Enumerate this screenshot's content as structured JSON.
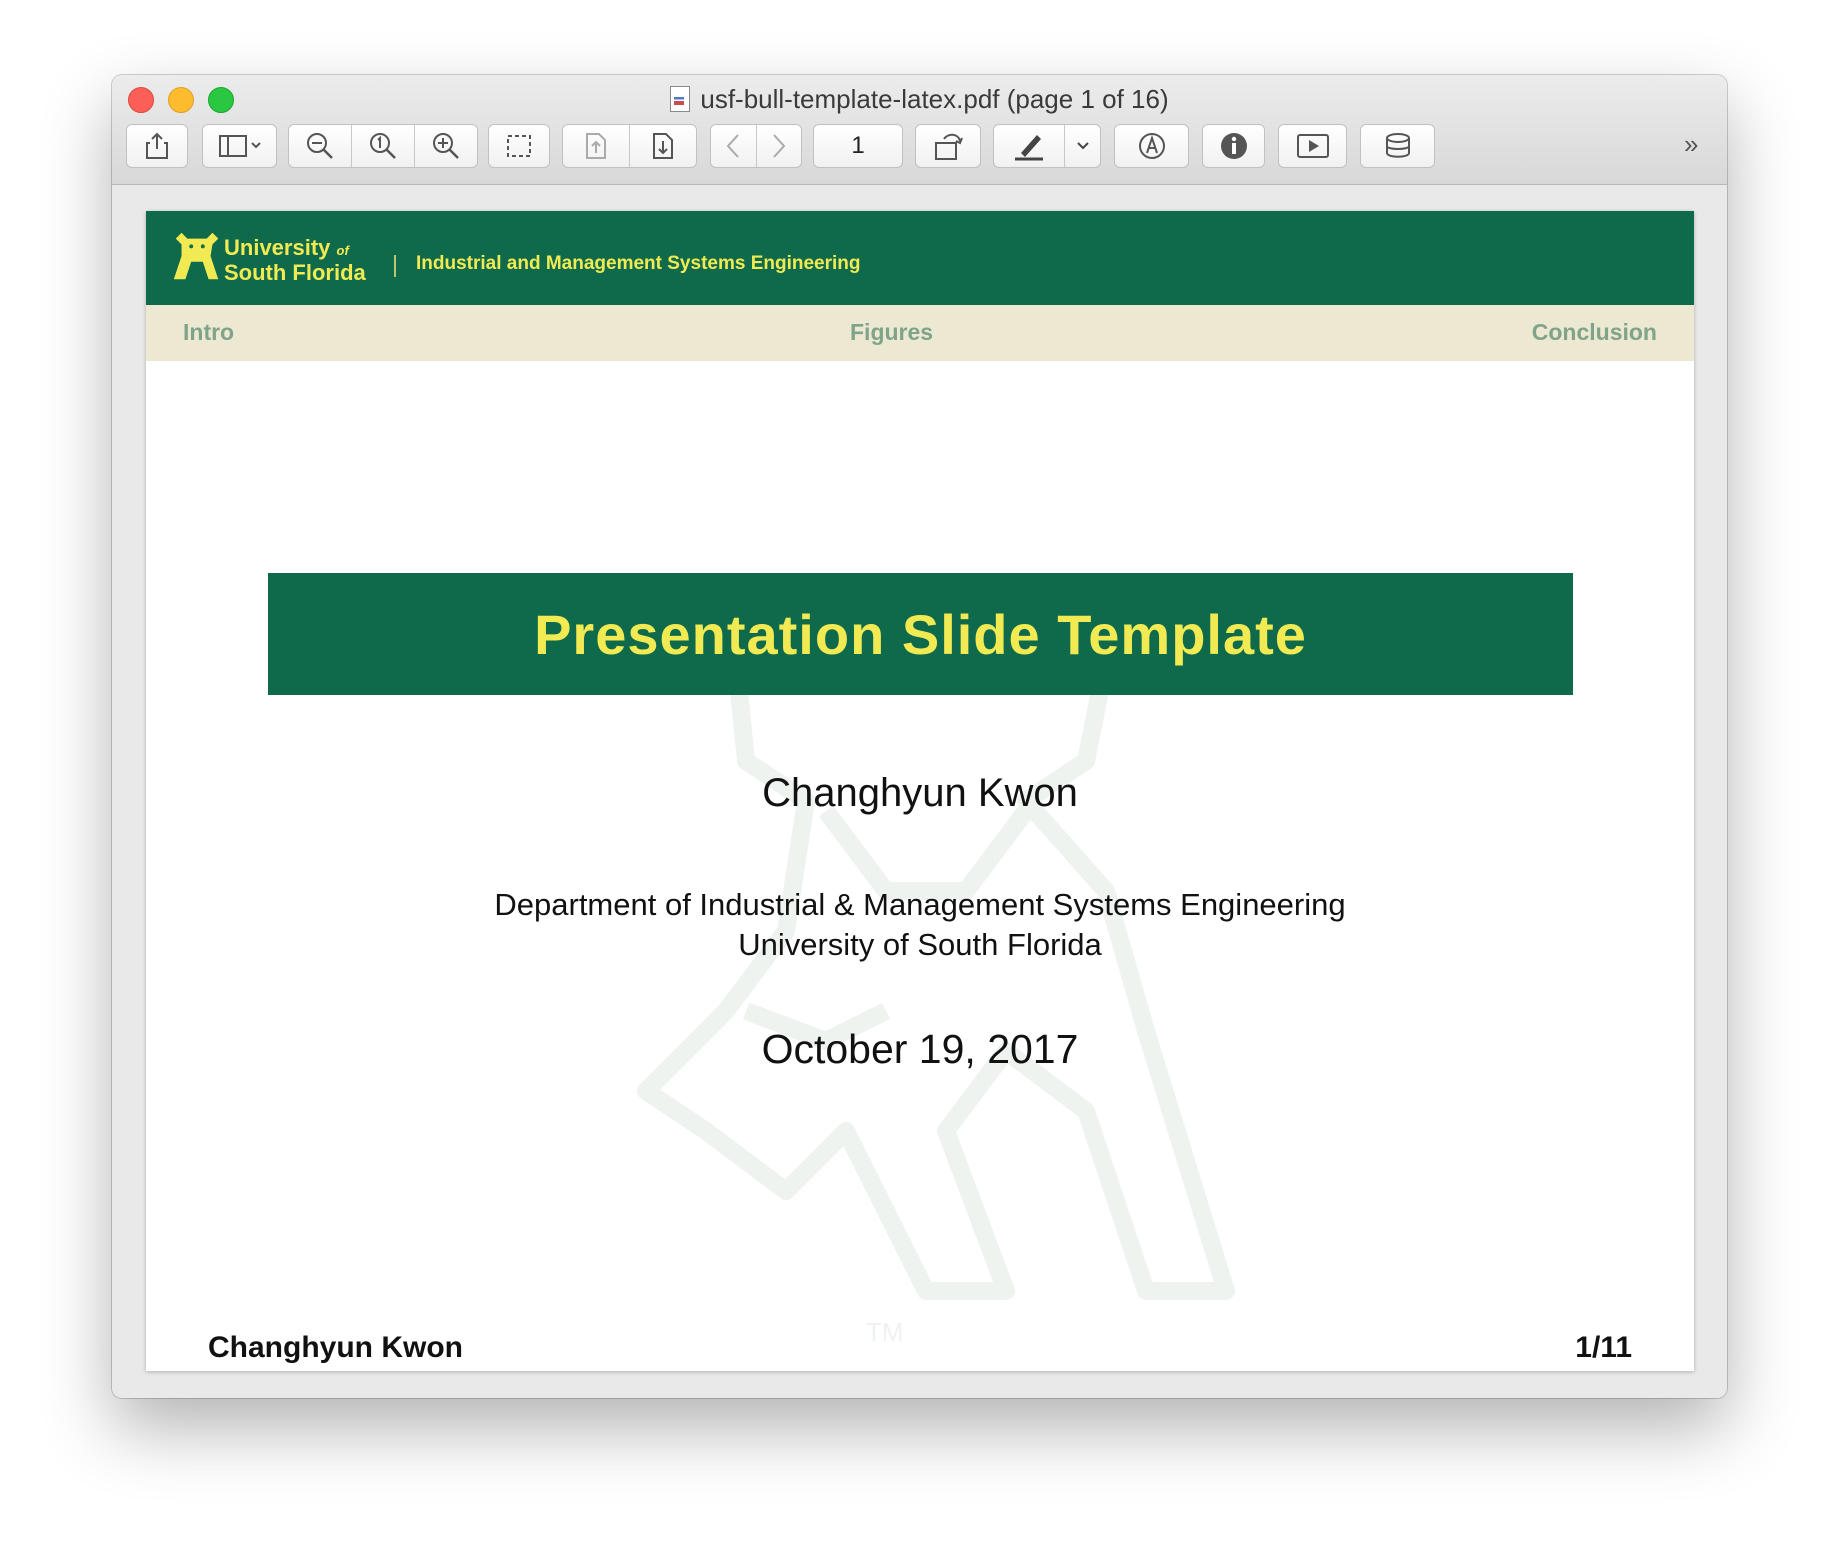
{
  "window": {
    "title": "usf-bull-template-latex.pdf (page 1 of 16)"
  },
  "toolbar": {
    "page_number": "1",
    "buttons": [
      "share-icon",
      "sidebar-icon",
      "zoom-out-icon",
      "actual-size-icon",
      "zoom-in-icon",
      "selection-icon",
      "page-up-icon",
      "page-down-icon",
      "back-icon",
      "forward-icon",
      "rotate-icon",
      "highlight-icon",
      "markup-icon",
      "info-icon",
      "slideshow-icon",
      "database-icon",
      "more-icon"
    ],
    "more": "»"
  },
  "slide": {
    "header": {
      "logo_line1": "University",
      "logo_of": "of",
      "logo_line2": "South Florida",
      "department": "Industrial and Management Systems Engineering"
    },
    "nav": {
      "items": [
        "Intro",
        "Figures",
        "Conclusion"
      ]
    },
    "title": "Presentation Slide Template",
    "author": "Changhyun Kwon",
    "affiliation_line1": "Department of Industrial & Management Systems Engineering",
    "affiliation_line2": "University of South Florida",
    "date": "October 19, 2017",
    "footer": {
      "author": "Changhyun Kwon",
      "page": "1/11"
    },
    "watermark_tm": "TM"
  },
  "colors": {
    "usf_green": "#0e6a4b",
    "usf_gold": "#f1ea52",
    "nav_bg": "#ece8d2",
    "nav_text": "#7fa48a"
  }
}
